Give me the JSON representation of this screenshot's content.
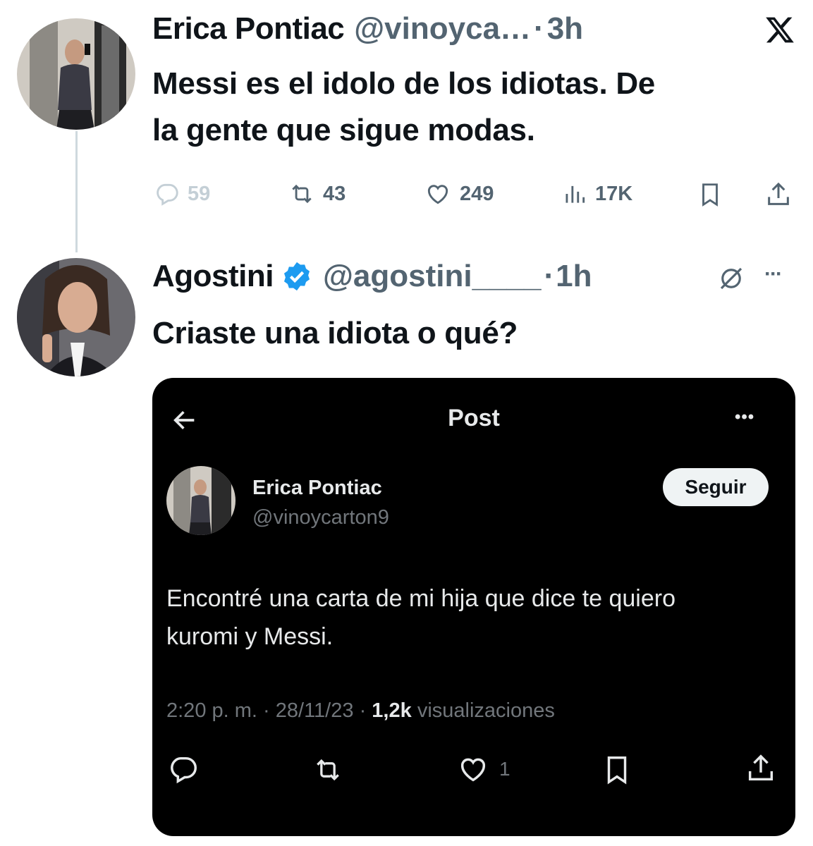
{
  "tweet1": {
    "name": "Erica Pontiac",
    "handle": "@vinoyca…",
    "separator": "·",
    "time": "3h",
    "text_line1": "Messi es el idolo de los idiotas. De",
    "text_line2": "la gente que sigue modas.",
    "replies": "59",
    "reposts": "43",
    "likes": "249",
    "views": "17K"
  },
  "tweet2": {
    "name": "Agostini",
    "handle": "@agostini____",
    "separator": "·",
    "time": "1h",
    "more": "···",
    "text": "Criaste una idiota o qué?"
  },
  "embedded": {
    "header_title": "Post",
    "more": "•••",
    "author_name": "Erica Pontiac",
    "author_handle": "@vinoycarton9",
    "follow_label": "Seguir",
    "text_line1": "Encontré una carta de mi hija que dice te quiero",
    "text_line2": "kuromi y Messi.",
    "time": "2:20 p. m.",
    "dot": "·",
    "date": "28/11/23",
    "views_count": "1,2k",
    "views_label": "visualizaciones",
    "likes": "1"
  },
  "colors": {
    "verified": "#1d9bf0",
    "muted": "#536471",
    "card_bg": "#000000"
  },
  "icons": [
    "x-logo-icon",
    "reply-icon",
    "repost-icon",
    "like-icon",
    "views-icon",
    "bookmark-icon",
    "share-icon",
    "verified-badge-icon",
    "grok-icon",
    "back-arrow-icon"
  ]
}
